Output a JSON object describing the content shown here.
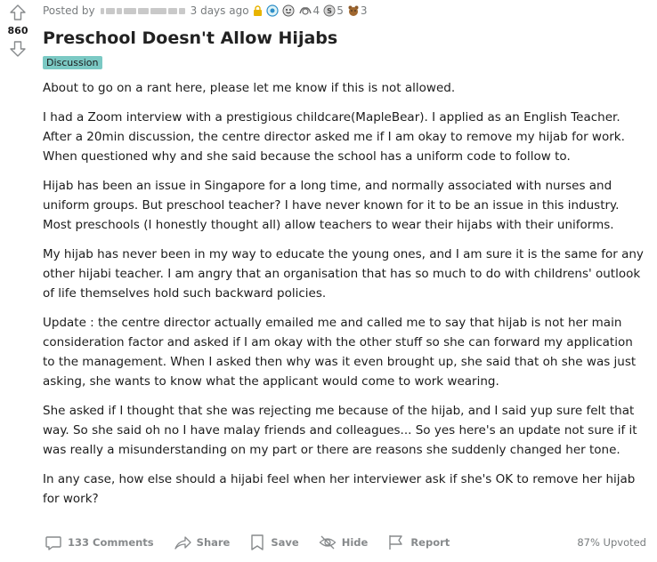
{
  "post": {
    "posted_by_label": "Posted by",
    "time_ago": "3 days ago",
    "vote_count": "860",
    "title": "Preschool Doesn't Allow Hijabs",
    "flair": "Discussion",
    "awards": [
      {
        "icon": "locked-icon",
        "color": "#e8b400",
        "count": ""
      },
      {
        "icon": "helpful-award-icon",
        "color": "#2f8fc9",
        "count": ""
      },
      {
        "icon": "wholesome-award-icon",
        "color": "#5a5a5a",
        "count": ""
      },
      {
        "icon": "hugz-award-icon",
        "color": "#6b6b6b",
        "count": "4"
      },
      {
        "icon": "silver-award-icon",
        "color": "#8a8a8a",
        "count": "5"
      },
      {
        "icon": "bear-award-icon",
        "color": "#8b5a2b",
        "count": "3"
      }
    ],
    "paragraphs": [
      "About to go on a rant here, please let me know if this is not allowed.",
      "I had a Zoom interview with a prestigious childcare(MapleBear). I applied as an English Teacher. After a 20min discussion, the centre director asked me if I am okay to remove my hijab for work. When questioned why and she said because the school has a uniform code to follow to.",
      "Hijab has been an issue in Singapore for a long time, and normally associated with nurses and uniform groups. But preschool teacher? I have never known for it to be an issue in this industry. Most preschools (I honestly thought all) allow teachers to wear their hijabs with their uniforms.",
      "My hijab has never been in my way to educate the young ones, and I am sure it is the same for any other hijabi teacher. I am angry that an organisation that has so much to do with childrens' outlook of life themselves hold such backward policies.",
      "Update : the centre director actually emailed me and called me to say that hijab is not her main consideration factor and asked if I am okay with the other stuff so she can forward my application to the management. When I asked then why was it even brought up, she said that oh she was just asking, she wants to know what the applicant would come to work wearing.",
      "She asked if I thought that she was rejecting me because of the hijab, and I said yup sure felt that way. So she said oh no I have malay friends and colleagues... So yes here's an update not sure if it was really a misunderstanding on my part or there are reasons she suddenly changed her tone.",
      "In any case, how else should a hijabi feel when her interviewer ask if she's OK to remove her hijab for work?"
    ]
  },
  "actions": {
    "comments_label": "133 Comments",
    "share_label": "Share",
    "save_label": "Save",
    "hide_label": "Hide",
    "report_label": "Report",
    "upvoted_label": "87% Upvoted"
  }
}
